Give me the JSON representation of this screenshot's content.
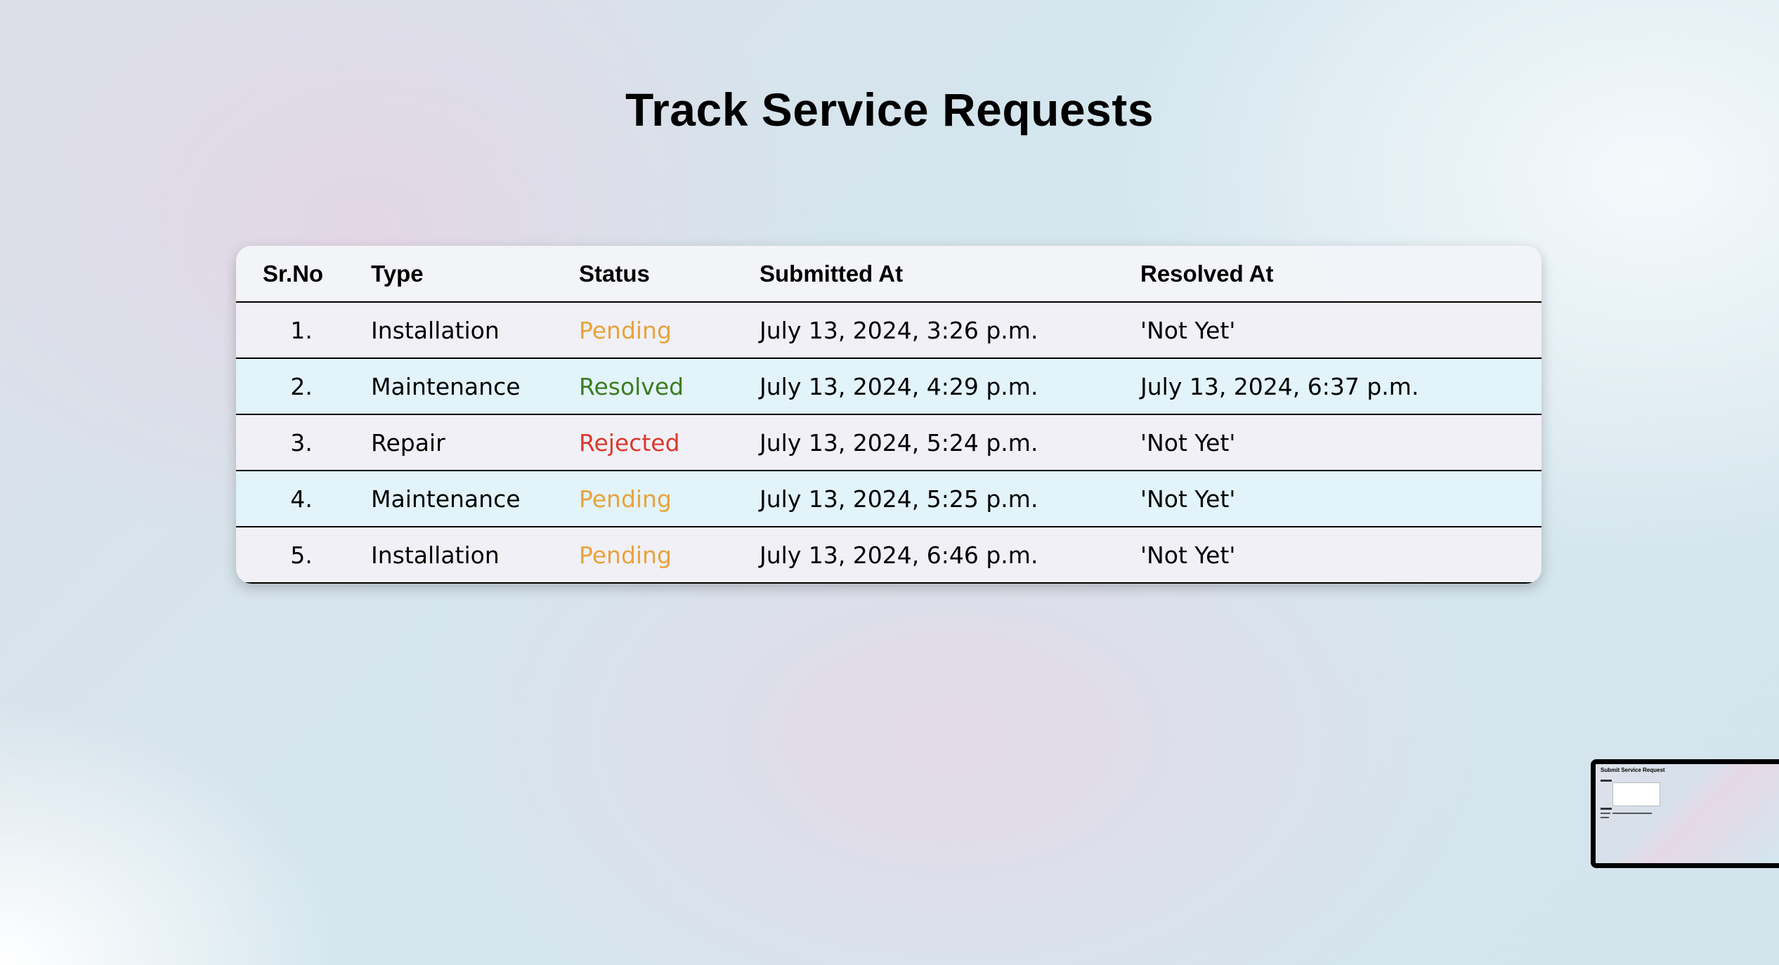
{
  "page": {
    "title": "Track Service Requests"
  },
  "table": {
    "headers": {
      "srno": "Sr.No",
      "type": "Type",
      "status": "Status",
      "submitted_at": "Submitted At",
      "resolved_at": "Resolved At"
    },
    "rows": [
      {
        "srno": "1.",
        "type": "Installation",
        "status": "Pending",
        "status_color": "#e8a33c",
        "submitted_at": "July 13, 2024, 3:26 p.m.",
        "resolved_at": "'Not Yet'"
      },
      {
        "srno": "2.",
        "type": "Maintenance",
        "status": "Resolved",
        "status_color": "#3c7c1f",
        "submitted_at": "July 13, 2024, 4:29 p.m.",
        "resolved_at": "July 13, 2024, 6:37 p.m."
      },
      {
        "srno": "3.",
        "type": "Repair",
        "status": "Rejected",
        "status_color": "#d93a2b",
        "submitted_at": "July 13, 2024, 5:24 p.m.",
        "resolved_at": "'Not Yet'"
      },
      {
        "srno": "4.",
        "type": "Maintenance",
        "status": "Pending",
        "status_color": "#e8a33c",
        "submitted_at": "July 13, 2024, 5:25 p.m.",
        "resolved_at": "'Not Yet'"
      },
      {
        "srno": "5.",
        "type": "Installation",
        "status": "Pending",
        "status_color": "#e8a33c",
        "submitted_at": "July 13, 2024, 6:46 p.m.",
        "resolved_at": "'Not Yet'"
      }
    ]
  },
  "thumbnail": {
    "title": "Submit Service Request"
  }
}
